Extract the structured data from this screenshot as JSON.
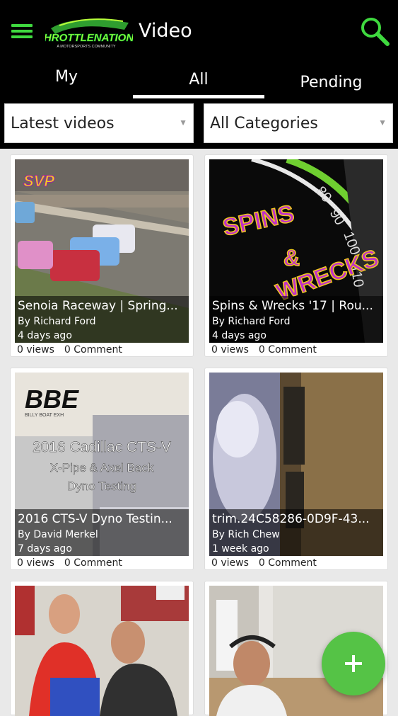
{
  "header": {
    "title": "Video",
    "logo_text": "THROTTLENATIONS",
    "logo_tagline": "A MOTORSPORTS COMMUNITY",
    "menu_icon": "hamburger-menu-icon",
    "search_icon": "search-icon",
    "accent_color": "#3fd93f"
  },
  "tabs": [
    {
      "label": "My",
      "active": false
    },
    {
      "label": "All",
      "active": true
    },
    {
      "label": "Pending",
      "active": false
    }
  ],
  "filters": {
    "sort": {
      "selected": "Latest videos"
    },
    "category": {
      "selected": "All Categories"
    }
  },
  "videos": [
    {
      "title": "Senoia Raceway | Spring...",
      "author": "By Richard Ford",
      "date": "4 days ago",
      "views": "0 views",
      "comments": "0 Comment",
      "thumb_logo": "SVP"
    },
    {
      "title": "Spins & Wrecks '17 | Rou...",
      "author": "By Richard Ford",
      "date": "4 days ago",
      "views": "0 views",
      "comments": "0 Comment",
      "thumb_lines": [
        "SPINS",
        "&",
        "WRECKS"
      ]
    },
    {
      "title": "2016 CTS-V Dyno Testin...",
      "author": "By David Merkel",
      "date": "7 days ago",
      "views": "0 views",
      "comments": "0 Comment",
      "thumb_lines": [
        "2016 Cadillac CTS-V",
        "X-Pipe & Axel Back",
        "Dyno Testing"
      ],
      "thumb_brand": "BBE",
      "thumb_brand_sub": "BILLY BOAT EXH"
    },
    {
      "title": "trim.24C58286-0D9F-43...",
      "author": "By Rich Chew",
      "date": "1 week ago",
      "views": "0 views",
      "comments": "0 Comment"
    },
    {
      "title": "",
      "author": "",
      "date": "",
      "views": "",
      "comments": ""
    },
    {
      "title": "",
      "author": "",
      "date": "",
      "views": "",
      "comments": ""
    }
  ],
  "fab": {
    "icon": "plus-icon",
    "color": "#55c346"
  }
}
